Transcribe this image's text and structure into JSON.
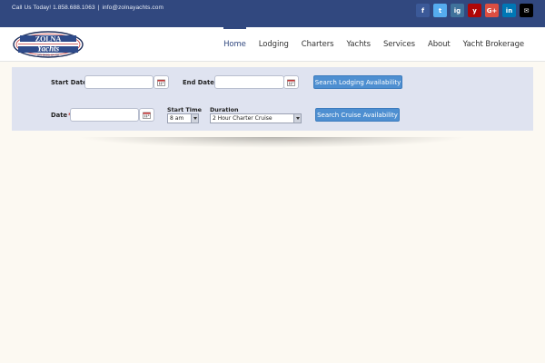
{
  "topbar": {
    "phone_text": "Call Us Today! 1.858.688.1063",
    "separator": "|",
    "email_text": "info@zolnayachts.com",
    "socials": [
      {
        "name": "facebook",
        "icon": "facebook-icon",
        "glyph": "f",
        "color": "#3b5998"
      },
      {
        "name": "twitter",
        "icon": "twitter-icon",
        "glyph": "t",
        "color": "#55acee"
      },
      {
        "name": "instagram",
        "icon": "instagram-icon",
        "glyph": "ig",
        "color": "#3f729b"
      },
      {
        "name": "yelp",
        "icon": "yelp-icon",
        "glyph": "y",
        "color": "#af0606"
      },
      {
        "name": "google-plus",
        "icon": "google-plus-icon",
        "glyph": "G+",
        "color": "#dc4e41"
      },
      {
        "name": "linkedin",
        "icon": "linkedin-icon",
        "glyph": "in",
        "color": "#0077b5"
      },
      {
        "name": "email",
        "icon": "mail-icon",
        "glyph": "✉",
        "color": "#000000"
      }
    ]
  },
  "logo": {
    "line1": "ZOLNA",
    "line2": "Yachts",
    "tagline": "SAN DIEGO, CA USA"
  },
  "nav": {
    "items": [
      {
        "label": "Home",
        "active": true
      },
      {
        "label": "Lodging",
        "active": false
      },
      {
        "label": "Charters",
        "active": false
      },
      {
        "label": "Yachts",
        "active": false
      },
      {
        "label": "Services",
        "active": false
      },
      {
        "label": "About",
        "active": false
      },
      {
        "label": "Yacht Brokerage",
        "active": false
      }
    ]
  },
  "lodging_form": {
    "start_date_label": "Start Date",
    "start_date_value": "",
    "end_date_label": "End Date",
    "end_date_value": "",
    "required_mark": "*",
    "search_button": "Search Lodging Availability"
  },
  "cruise_form": {
    "date_label": "Date",
    "date_value": "",
    "required_mark": "*",
    "start_time_label": "Start Time",
    "start_time_value": "8 am",
    "duration_label": "Duration",
    "duration_value": "2 Hour Charter Cruise",
    "search_button": "Search Cruise Availability"
  },
  "colors": {
    "topbar": "#31487f",
    "accent": "#31487f",
    "button": "#4e8fd1",
    "form_panel": "#dfe3f0",
    "page_bg": "#fcf9f2"
  }
}
